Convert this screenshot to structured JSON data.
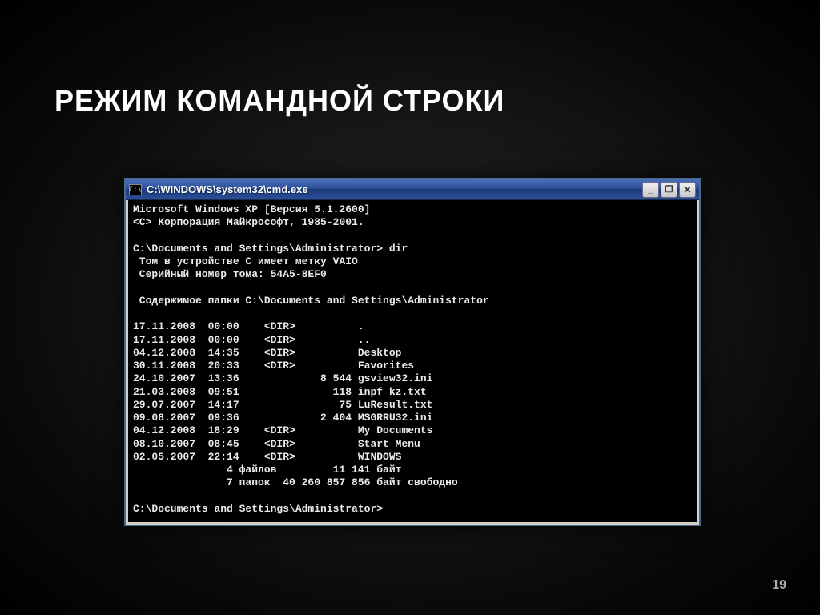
{
  "slide": {
    "title": "РЕЖИМ КОМАНДНОЙ СТРОКИ",
    "page_number": "19"
  },
  "window": {
    "icon_glyph": "C:\\",
    "title": "C:\\WINDOWS\\system32\\cmd.exe",
    "buttons": {
      "minimize": "_",
      "maximize": "❐",
      "close": "✕"
    }
  },
  "console": {
    "header1": "Microsoft Windows XP [Версия 5.1.2600]",
    "header2": "<C> Корпорация Майкрософт, 1985-2001.",
    "blank": "",
    "prompt1": "C:\\Documents and Settings\\Administrator> dir",
    "vol1": " Том в устройстве C имеет метку VAIO",
    "vol2": " Серийный номер тома: 54A5-8EF0",
    "content_hdr": " Содержимое папки C:\\Documents and Settings\\Administrator",
    "rows": [
      "17.11.2008  00:00    <DIR>          .",
      "17.11.2008  00:00    <DIR>          ..",
      "04.12.2008  14:35    <DIR>          Desktop",
      "30.11.2008  20:33    <DIR>          Favorites",
      "24.10.2007  13:36             8 544 gsview32.ini",
      "21.03.2008  09:51               118 inpf_kz.txt",
      "29.07.2007  14:17                75 LuResult.txt",
      "09.08.2007  09:36             2 404 MSGRRU32.ini",
      "04.12.2008  18:29    <DIR>          My Documents",
      "08.10.2007  08:45    <DIR>          Start Menu",
      "02.05.2007  22:14    <DIR>          WINDOWS"
    ],
    "summary1": "               4 файлов         11 141 байт",
    "summary2": "               7 папок  40 260 857 856 байт свободно",
    "prompt2": "C:\\Documents and Settings\\Administrator>"
  }
}
